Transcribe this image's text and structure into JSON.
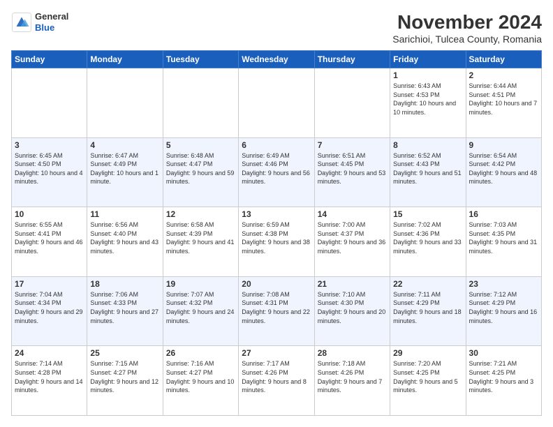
{
  "header": {
    "logo_general": "General",
    "logo_blue": "Blue",
    "title": "November 2024",
    "subtitle": "Sarichioi, Tulcea County, Romania"
  },
  "calendar": {
    "headers": [
      "Sunday",
      "Monday",
      "Tuesday",
      "Wednesday",
      "Thursday",
      "Friday",
      "Saturday"
    ],
    "rows": [
      [
        {
          "day": "",
          "info": ""
        },
        {
          "day": "",
          "info": ""
        },
        {
          "day": "",
          "info": ""
        },
        {
          "day": "",
          "info": ""
        },
        {
          "day": "",
          "info": ""
        },
        {
          "day": "1",
          "info": "Sunrise: 6:43 AM\nSunset: 4:53 PM\nDaylight: 10 hours and 10 minutes."
        },
        {
          "day": "2",
          "info": "Sunrise: 6:44 AM\nSunset: 4:51 PM\nDaylight: 10 hours and 7 minutes."
        }
      ],
      [
        {
          "day": "3",
          "info": "Sunrise: 6:45 AM\nSunset: 4:50 PM\nDaylight: 10 hours and 4 minutes."
        },
        {
          "day": "4",
          "info": "Sunrise: 6:47 AM\nSunset: 4:49 PM\nDaylight: 10 hours and 1 minute."
        },
        {
          "day": "5",
          "info": "Sunrise: 6:48 AM\nSunset: 4:47 PM\nDaylight: 9 hours and 59 minutes."
        },
        {
          "day": "6",
          "info": "Sunrise: 6:49 AM\nSunset: 4:46 PM\nDaylight: 9 hours and 56 minutes."
        },
        {
          "day": "7",
          "info": "Sunrise: 6:51 AM\nSunset: 4:45 PM\nDaylight: 9 hours and 53 minutes."
        },
        {
          "day": "8",
          "info": "Sunrise: 6:52 AM\nSunset: 4:43 PM\nDaylight: 9 hours and 51 minutes."
        },
        {
          "day": "9",
          "info": "Sunrise: 6:54 AM\nSunset: 4:42 PM\nDaylight: 9 hours and 48 minutes."
        }
      ],
      [
        {
          "day": "10",
          "info": "Sunrise: 6:55 AM\nSunset: 4:41 PM\nDaylight: 9 hours and 46 minutes."
        },
        {
          "day": "11",
          "info": "Sunrise: 6:56 AM\nSunset: 4:40 PM\nDaylight: 9 hours and 43 minutes."
        },
        {
          "day": "12",
          "info": "Sunrise: 6:58 AM\nSunset: 4:39 PM\nDaylight: 9 hours and 41 minutes."
        },
        {
          "day": "13",
          "info": "Sunrise: 6:59 AM\nSunset: 4:38 PM\nDaylight: 9 hours and 38 minutes."
        },
        {
          "day": "14",
          "info": "Sunrise: 7:00 AM\nSunset: 4:37 PM\nDaylight: 9 hours and 36 minutes."
        },
        {
          "day": "15",
          "info": "Sunrise: 7:02 AM\nSunset: 4:36 PM\nDaylight: 9 hours and 33 minutes."
        },
        {
          "day": "16",
          "info": "Sunrise: 7:03 AM\nSunset: 4:35 PM\nDaylight: 9 hours and 31 minutes."
        }
      ],
      [
        {
          "day": "17",
          "info": "Sunrise: 7:04 AM\nSunset: 4:34 PM\nDaylight: 9 hours and 29 minutes."
        },
        {
          "day": "18",
          "info": "Sunrise: 7:06 AM\nSunset: 4:33 PM\nDaylight: 9 hours and 27 minutes."
        },
        {
          "day": "19",
          "info": "Sunrise: 7:07 AM\nSunset: 4:32 PM\nDaylight: 9 hours and 24 minutes."
        },
        {
          "day": "20",
          "info": "Sunrise: 7:08 AM\nSunset: 4:31 PM\nDaylight: 9 hours and 22 minutes."
        },
        {
          "day": "21",
          "info": "Sunrise: 7:10 AM\nSunset: 4:30 PM\nDaylight: 9 hours and 20 minutes."
        },
        {
          "day": "22",
          "info": "Sunrise: 7:11 AM\nSunset: 4:29 PM\nDaylight: 9 hours and 18 minutes."
        },
        {
          "day": "23",
          "info": "Sunrise: 7:12 AM\nSunset: 4:29 PM\nDaylight: 9 hours and 16 minutes."
        }
      ],
      [
        {
          "day": "24",
          "info": "Sunrise: 7:14 AM\nSunset: 4:28 PM\nDaylight: 9 hours and 14 minutes."
        },
        {
          "day": "25",
          "info": "Sunrise: 7:15 AM\nSunset: 4:27 PM\nDaylight: 9 hours and 12 minutes."
        },
        {
          "day": "26",
          "info": "Sunrise: 7:16 AM\nSunset: 4:27 PM\nDaylight: 9 hours and 10 minutes."
        },
        {
          "day": "27",
          "info": "Sunrise: 7:17 AM\nSunset: 4:26 PM\nDaylight: 9 hours and 8 minutes."
        },
        {
          "day": "28",
          "info": "Sunrise: 7:18 AM\nSunset: 4:26 PM\nDaylight: 9 hours and 7 minutes."
        },
        {
          "day": "29",
          "info": "Sunrise: 7:20 AM\nSunset: 4:25 PM\nDaylight: 9 hours and 5 minutes."
        },
        {
          "day": "30",
          "info": "Sunrise: 7:21 AM\nSunset: 4:25 PM\nDaylight: 9 hours and 3 minutes."
        }
      ]
    ]
  }
}
